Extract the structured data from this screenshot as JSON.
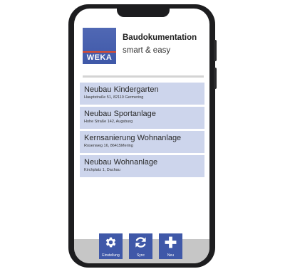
{
  "header": {
    "logo_text": "WEKA",
    "title": "Baudokumentation",
    "subtitle": "smart & easy"
  },
  "projects": [
    {
      "title": "Neubau Kindergarten",
      "address": "Hauptstraße 51, 82110 Germering"
    },
    {
      "title": "Neubau Sportanlage",
      "address": "Hohe Straße 142, Augsburg"
    },
    {
      "title": "Kernsanierung Wohnanlage",
      "address": "Rosenweg 16, 86415Mering"
    },
    {
      "title": "Neubau Wohnanlage",
      "address": "Kirchplatz 1, Dachau"
    }
  ],
  "toolbar": {
    "settings_label": "Einstellung",
    "sync_label": "Sync",
    "new_label": "Neu"
  },
  "colors": {
    "brand_blue": "#3f58a8",
    "list_item_bg": "#cdd5ec",
    "toolbar_bg": "#c6c6c6",
    "logo_accent": "#e04a2a",
    "phone_frame": "#1d1d1f"
  },
  "icons": {
    "settings": "gear-icon",
    "sync": "sync-icon",
    "new": "plus-icon"
  }
}
